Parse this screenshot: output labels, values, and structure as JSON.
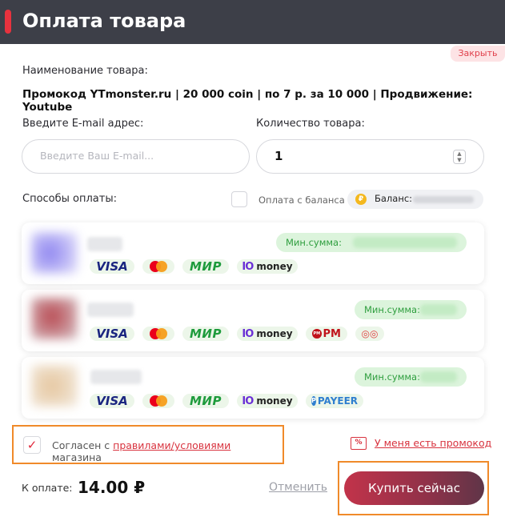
{
  "header": {
    "title": "Оплата товара",
    "accent_color": "#e8323e",
    "background": "#3d3f48"
  },
  "close_label": "Закрыть",
  "product": {
    "label": "Наименование товара:",
    "name": "Промокод YTmonster.ru | 20 000 coin | по 7 р. за 10 000 | Продвижение: Youtube"
  },
  "email": {
    "label": "Введите E-mail адрес:",
    "placeholder": "Введите Ваш E-mail..."
  },
  "quantity": {
    "label": "Количество товара:",
    "value": "1"
  },
  "payment": {
    "label": "Способы оплаты:",
    "balance_option_label": "Оплата с баланса",
    "balance_label": "Баланс:",
    "methods": [
      {
        "min_label": "Мин.сумма:",
        "logos": [
          "visa-logo",
          "mastercard-logo",
          "mir-logo",
          "yoomoney-logo"
        ]
      },
      {
        "min_label": "Мин.сумма:",
        "logos": [
          "visa-logo",
          "mastercard-logo",
          "mir-logo",
          "yoomoney-logo",
          "perfectmoney-logo",
          "extra-logo"
        ]
      },
      {
        "min_label": "Мин.сумма:",
        "logos": [
          "visa-logo",
          "mastercard-logo",
          "mir-logo",
          "yoomoney-logo",
          "payeer-logo"
        ]
      }
    ],
    "logo_text": {
      "visa": "VISA",
      "mir": "МИР",
      "yoomoney": "money",
      "pm": "PM",
      "payeer": "PAYEER"
    }
  },
  "agree": {
    "prefix": "Согласен с ",
    "link": "правилами/условиями",
    "suffix": " магазина",
    "checked": true
  },
  "promo_label": "У меня есть промокод",
  "total": {
    "label": "К оплате:",
    "amount": "14.00 ₽"
  },
  "cancel_label": "Отменить",
  "buy_label": "Купить сейчас",
  "colors": {
    "accent": "#d8323e",
    "highlight": "#f08a2a",
    "success_bg": "#dcf4dc",
    "success_text": "#2e9e3e"
  }
}
